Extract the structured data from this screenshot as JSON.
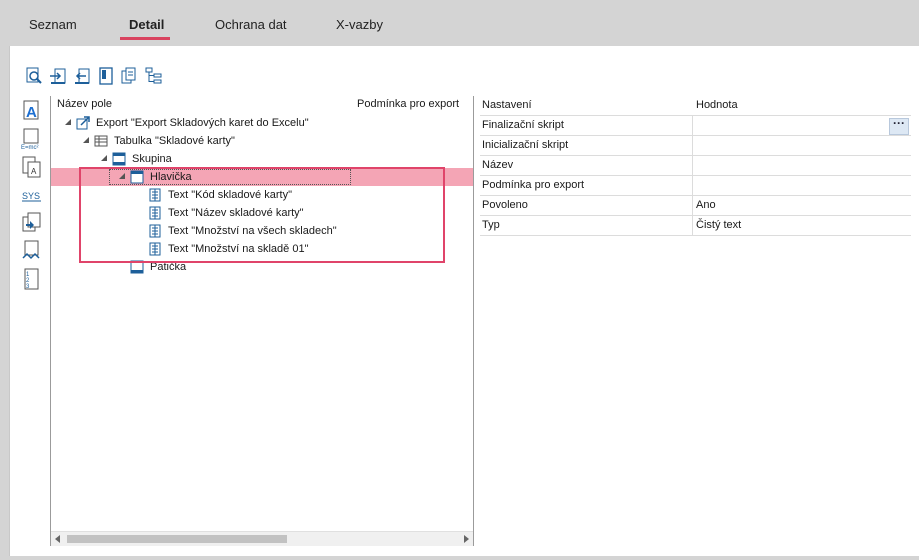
{
  "tabs": [
    {
      "label": "Seznam"
    },
    {
      "label": "Detail"
    },
    {
      "label": "Ochrana dat"
    },
    {
      "label": "X-vazby"
    }
  ],
  "tree": {
    "col_name": "Název pole",
    "col_condition": "Podmínka pro export",
    "nodes": [
      {
        "label": "Export \"Export Skladových karet do Excelu\""
      },
      {
        "label": "Tabulka \"Skladové karty\""
      },
      {
        "label": "Skupina"
      },
      {
        "label": "Hlavička"
      },
      {
        "label": "Text \"Kód skladové karty\""
      },
      {
        "label": "Text \"Název skladové karty\""
      },
      {
        "label": "Text \"Množství na všech skladech\""
      },
      {
        "label": "Text \"Množství na skladě 01\""
      },
      {
        "label": "Patička"
      }
    ]
  },
  "props": {
    "col_setting": "Nastavení",
    "col_value": "Hodnota",
    "rows": [
      {
        "key": "Finalizační skript",
        "value": ""
      },
      {
        "key": "Inicializační skript",
        "value": ""
      },
      {
        "key": "Název",
        "value": ""
      },
      {
        "key": "Podmínka pro export",
        "value": ""
      },
      {
        "key": "Povoleno",
        "value": "Ano"
      },
      {
        "key": "Typ",
        "value": "Čistý text"
      }
    ],
    "ellipsis": "···"
  },
  "colors": {
    "accent": "#d9435f",
    "selection": "#f4a5b5",
    "highlight_border": "#e0446a"
  }
}
